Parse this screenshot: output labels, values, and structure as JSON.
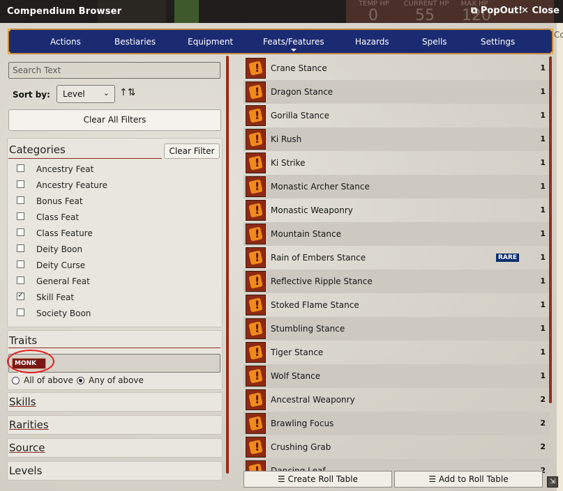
{
  "window": {
    "title": "Compendium Browser",
    "popout_label": "PopOut!",
    "close_label": "Close"
  },
  "background_hud": {
    "temp_hp_label": "TEMP HP",
    "temp_hp_value": "0",
    "current_hp_label": "CURRENT HP",
    "current_hp_value": "55",
    "max_hp_label": "MAX HP",
    "max_hp_value": "120",
    "side_text": "Core Sk"
  },
  "nav": {
    "tabs": [
      "Actions",
      "Bestiaries",
      "Equipment",
      "Feats/Features",
      "Hazards",
      "Spells",
      "Settings"
    ],
    "active_tab": "Feats/Features"
  },
  "filters": {
    "search_placeholder": "Search Text",
    "sort_label": "Sort by:",
    "sort_value": "Level",
    "sort_direction_icon": "sort-ascending-icon",
    "clear_all_label": "Clear All Filters",
    "categories_title": "Categories",
    "clear_filter_label": "Clear Filter",
    "categories": [
      {
        "label": "Ancestry Feat",
        "checked": false
      },
      {
        "label": "Ancestry Feature",
        "checked": false
      },
      {
        "label": "Bonus Feat",
        "checked": false
      },
      {
        "label": "Class Feat",
        "checked": false
      },
      {
        "label": "Class Feature",
        "checked": false
      },
      {
        "label": "Deity Boon",
        "checked": false
      },
      {
        "label": "Deity Curse",
        "checked": false
      },
      {
        "label": "General Feat",
        "checked": false
      },
      {
        "label": "Skill Feat",
        "checked": true
      },
      {
        "label": "Society Boon",
        "checked": false
      }
    ],
    "traits_title": "Traits",
    "trait_chip": "MONK",
    "trait_chip_remove": "×",
    "match_all_label": "All of above",
    "match_any_label": "Any of above",
    "match_mode": "any",
    "collapsed_sections": [
      "Skills",
      "Rarities",
      "Source",
      "Levels"
    ]
  },
  "results": [
    {
      "name": "Crane Stance",
      "level": "1"
    },
    {
      "name": "Dragon Stance",
      "level": "1"
    },
    {
      "name": "Gorilla Stance",
      "level": "1"
    },
    {
      "name": "Ki Rush",
      "level": "1"
    },
    {
      "name": "Ki Strike",
      "level": "1"
    },
    {
      "name": "Monastic Archer Stance",
      "level": "1"
    },
    {
      "name": "Monastic Weaponry",
      "level": "1"
    },
    {
      "name": "Mountain Stance",
      "level": "1"
    },
    {
      "name": "Rain of Embers Stance",
      "level": "1",
      "badge": "RARE"
    },
    {
      "name": "Reflective Ripple Stance",
      "level": "1"
    },
    {
      "name": "Stoked Flame Stance",
      "level": "1"
    },
    {
      "name": "Stumbling Stance",
      "level": "1"
    },
    {
      "name": "Tiger Stance",
      "level": "1"
    },
    {
      "name": "Wolf Stance",
      "level": "1"
    },
    {
      "name": "Ancestral Weaponry",
      "level": "2"
    },
    {
      "name": "Brawling Focus",
      "level": "2"
    },
    {
      "name": "Crushing Grab",
      "level": "2"
    },
    {
      "name": "Dancing Leaf",
      "level": "2"
    }
  ],
  "footer": {
    "create_roll_table": "Create Roll Table",
    "add_to_roll_table": "Add to Roll Table"
  },
  "colors": {
    "nav_bg": "#1b2b72",
    "accent_red": "#9b2b18",
    "chip_bg": "#7a1815",
    "rare_badge": "#0e2f6d",
    "highlight_ring": "#e31b1b"
  }
}
